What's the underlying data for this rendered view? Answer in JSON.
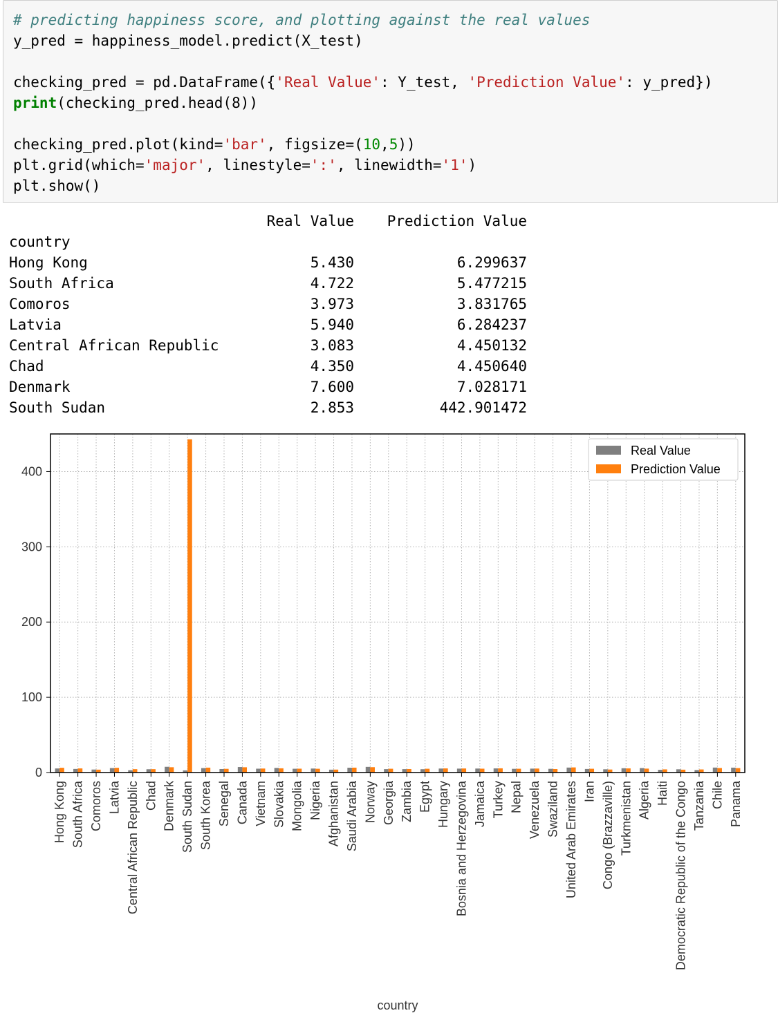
{
  "code": {
    "comment": "# predicting happiness score, and plotting against the real values",
    "line2": "y_pred = happiness_model.predict(X_test)",
    "line4_a": "checking_pred = pd.DataFrame({",
    "line4_s1": "'Real Value'",
    "line4_b": ": Y_test, ",
    "line4_s2": "'Prediction Value'",
    "line4_c": ": y_pred})",
    "line5_kw": "print",
    "line5_rest": "(checking_pred.head(8))",
    "line7_a": "checking_pred.plot(kind=",
    "line7_s": "'bar'",
    "line7_b": ", figsize=(",
    "line7_n1": "10",
    "line7_c": ",",
    "line7_n2": "5",
    "line7_d": "))",
    "line8_a": "plt.grid(which=",
    "line8_s1": "'major'",
    "line8_b": ", linestyle=",
    "line8_s2": "':'",
    "line8_c": ", linewidth=",
    "line8_s3": "'1'",
    "line8_d": ")",
    "line9": "plt.show()"
  },
  "output": {
    "header_real": "Real Value",
    "header_pred": "Prediction Value",
    "index_name": "country",
    "rows": [
      {
        "country": "Hong Kong",
        "real": "5.430",
        "pred": "6.299637"
      },
      {
        "country": "South Africa",
        "real": "4.722",
        "pred": "5.477215"
      },
      {
        "country": "Comoros",
        "real": "3.973",
        "pred": "3.831765"
      },
      {
        "country": "Latvia",
        "real": "5.940",
        "pred": "6.284237"
      },
      {
        "country": "Central African Republic",
        "real": "3.083",
        "pred": "4.450132"
      },
      {
        "country": "Chad",
        "real": "4.350",
        "pred": "4.450640"
      },
      {
        "country": "Denmark",
        "real": "7.600",
        "pred": "7.028171"
      },
      {
        "country": "South Sudan",
        "real": "2.853",
        "pred": "442.901472"
      }
    ]
  },
  "chart_data": {
    "type": "bar",
    "xlabel": "country",
    "ylabel": "",
    "ylim": [
      0,
      450
    ],
    "yticks": [
      0,
      100,
      200,
      300,
      400
    ],
    "grid": true,
    "legend_position": "top-right",
    "categories": [
      "Hong Kong",
      "South Africa",
      "Comoros",
      "Latvia",
      "Central African Republic",
      "Chad",
      "Denmark",
      "South Sudan",
      "South Korea",
      "Senegal",
      "Canada",
      "Vietnam",
      "Slovakia",
      "Mongolia",
      "Nigeria",
      "Afghanistan",
      "Saudi Arabia",
      "Norway",
      "Georgia",
      "Zambia",
      "Egypt",
      "Hungary",
      "Bosnia and Herzegovina",
      "Jamaica",
      "Turkey",
      "Nepal",
      "Venezuela",
      "Swaziland",
      "United Arab Emirates",
      "Iran",
      "Congo (Brazzaville)",
      "Turkmenistan",
      "Algeria",
      "Haiti",
      "Democratic Republic of the Congo",
      "Tanzania",
      "Chile",
      "Panama"
    ],
    "series": [
      {
        "name": "Real Value",
        "color": "#7f7f7f",
        "values": [
          5.43,
          4.722,
          3.973,
          5.94,
          3.083,
          4.35,
          7.6,
          2.853,
          5.9,
          4.6,
          7.3,
          5.1,
          6.1,
          5.0,
          5.3,
          3.8,
          6.4,
          7.5,
          4.5,
          4.5,
          4.4,
          5.3,
          5.2,
          5.3,
          5.5,
          4.9,
          5.2,
          4.9,
          6.6,
          4.7,
          4.3,
          5.7,
          5.9,
          3.6,
          4.3,
          3.3,
          6.6,
          6.5
        ]
      },
      {
        "name": "Prediction Value",
        "color": "#ff7f0e",
        "values": [
          6.299637,
          5.477215,
          3.831765,
          6.284237,
          4.450132,
          4.45064,
          7.028171,
          442.901472,
          6.5,
          4.9,
          7.0,
          5.3,
          5.6,
          5.1,
          5.0,
          3.9,
          6.5,
          7.1,
          5.0,
          4.6,
          5.0,
          5.5,
          5.4,
          5.1,
          5.6,
          5.0,
          5.3,
          4.6,
          6.8,
          5.0,
          4.0,
          5.5,
          5.2,
          4.2,
          3.8,
          4.1,
          6.0,
          5.9
        ]
      }
    ]
  }
}
